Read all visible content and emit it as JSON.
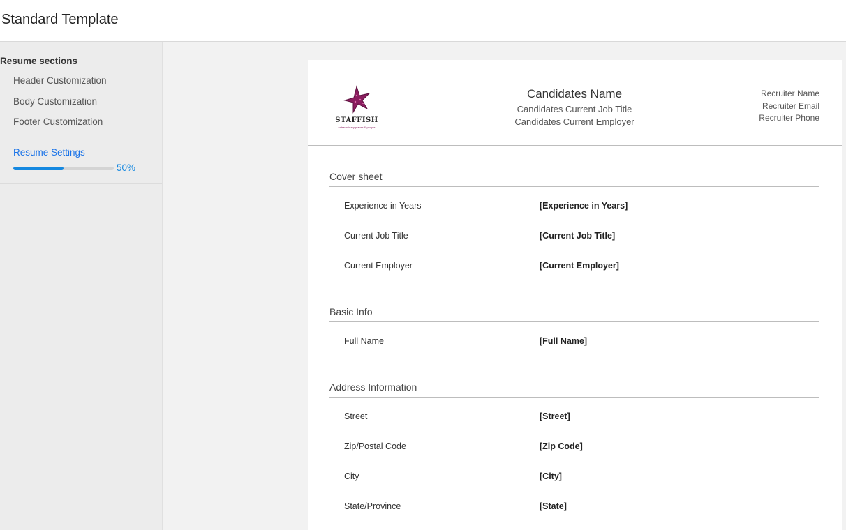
{
  "page": {
    "title": "Standard Template"
  },
  "sidebar": {
    "heading": "Resume sections",
    "items": [
      {
        "label": "Header Customization"
      },
      {
        "label": "Body Customization"
      },
      {
        "label": "Footer Customization"
      }
    ],
    "settings": {
      "label": "Resume Settings",
      "progress_percent": 50,
      "progress_text": "50%"
    }
  },
  "doc": {
    "logo": {
      "brand": "STAFFISH",
      "tagline": "extraordinary places & people",
      "icon": "starfish-icon",
      "color": "#8b1d5f"
    },
    "candidate": {
      "name": "Candidates Name",
      "job_title": "Candidates Current Job Title",
      "employer": "Candidates Current Employer"
    },
    "recruiter": {
      "name": "Recruiter Name",
      "email": "Recruiter Email",
      "phone": "Recruiter Phone"
    },
    "sections": [
      {
        "title": "Cover sheet",
        "fields": [
          {
            "label": "Experience in Years",
            "value": "[Experience in Years]"
          },
          {
            "label": "Current Job Title",
            "value": "[Current Job Title]"
          },
          {
            "label": "Current Employer",
            "value": "[Current Employer]"
          }
        ]
      },
      {
        "title": "Basic Info",
        "fields": [
          {
            "label": "Full Name",
            "value": "[Full Name]"
          }
        ]
      },
      {
        "title": "Address Information",
        "fields": [
          {
            "label": "Street",
            "value": "[Street]"
          },
          {
            "label": "Zip/Postal Code",
            "value": "[Zip Code]"
          },
          {
            "label": "City",
            "value": "[City]"
          },
          {
            "label": "State/Province",
            "value": "[State]"
          }
        ]
      }
    ]
  },
  "colors": {
    "accent": "#1588e0",
    "link": "#1a73e8"
  }
}
